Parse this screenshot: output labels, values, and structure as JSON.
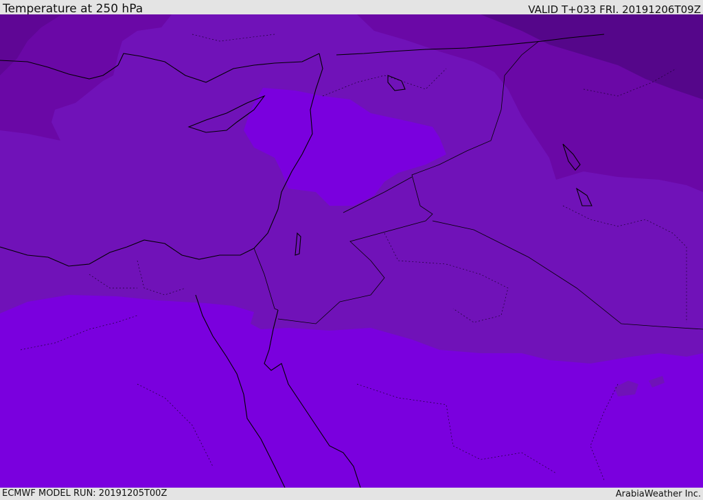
{
  "header": {
    "title": "Temperature at 250 hPa",
    "valid_time": "VALID T+033 FRI. 20191206T09Z"
  },
  "footer": {
    "model_run": "ECMWF MODEL RUN: 20191205T00Z",
    "credit": "ArabiaWeather Inc."
  },
  "map": {
    "colors": {
      "warmest_band": "#7a00de",
      "mid_band": "#7012b8",
      "cool_band": "#6a08a6",
      "cold_band": "#5f0695",
      "coldest_band": "#55068a",
      "coastline": "#000000"
    }
  }
}
